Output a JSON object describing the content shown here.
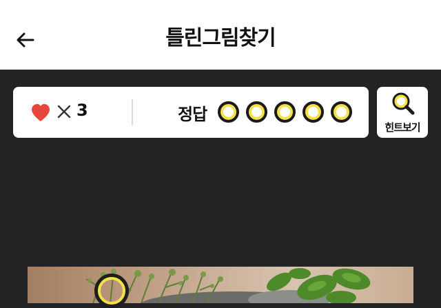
{
  "header": {
    "title": "틀린그림찾기",
    "back_icon": "arrow-left-icon"
  },
  "status": {
    "heart_icon": "heart-icon",
    "heart_color": "#e8453c",
    "times_icon": "close-x-icon",
    "lives": "3",
    "answer_label": "정답",
    "answer_total": 5,
    "answers_found": 0,
    "slot_color": "#f4e14a"
  },
  "hint": {
    "label": "힌트보기",
    "icon": "magnifier-icon"
  },
  "puzzle": {
    "image": "herb-plants-photo",
    "markers_visible": 1
  }
}
